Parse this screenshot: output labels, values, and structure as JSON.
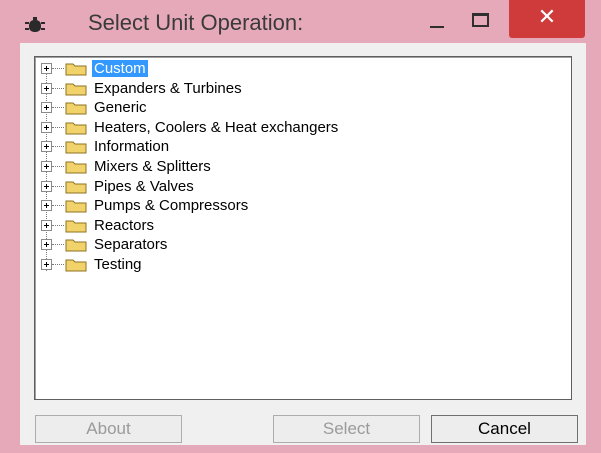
{
  "window": {
    "title": "Select Unit Operation:",
    "icon": "unit-operation-icon",
    "close_glyph": "✕"
  },
  "tree": {
    "items": [
      {
        "label": "Custom",
        "selected": true,
        "icon": "folder-icon"
      },
      {
        "label": "Expanders & Turbines",
        "selected": false,
        "icon": "folder-icon"
      },
      {
        "label": "Generic",
        "selected": false,
        "icon": "folder-icon"
      },
      {
        "label": "Heaters, Coolers & Heat exchangers",
        "selected": false,
        "icon": "folder-icon"
      },
      {
        "label": "Information",
        "selected": false,
        "icon": "folder-icon"
      },
      {
        "label": "Mixers & Splitters",
        "selected": false,
        "icon": "folder-icon"
      },
      {
        "label": "Pipes & Valves",
        "selected": false,
        "icon": "folder-icon"
      },
      {
        "label": "Pumps & Compressors",
        "selected": false,
        "icon": "folder-icon"
      },
      {
        "label": "Reactors",
        "selected": false,
        "icon": "folder-icon"
      },
      {
        "label": "Separators",
        "selected": false,
        "icon": "folder-icon"
      },
      {
        "label": "Testing",
        "selected": false,
        "icon": "folder-icon"
      }
    ]
  },
  "buttons": {
    "about": "About",
    "select": "Select",
    "cancel": "Cancel"
  },
  "colors": {
    "frame": "#e6a9b9",
    "close": "#cf3b3b",
    "selection": "#3399ff",
    "folder": "#f2d36b"
  }
}
